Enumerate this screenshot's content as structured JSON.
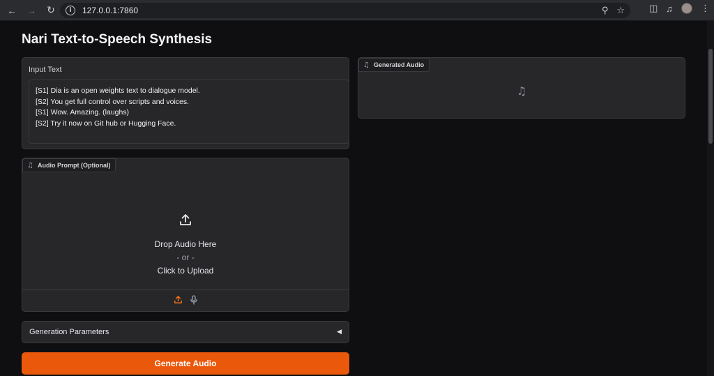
{
  "browser": {
    "url": "127.0.0.1:7860",
    "icons": [
      "back-icon",
      "forward-icon",
      "reload-icon",
      "info-icon",
      "zoom-icon",
      "star-icon",
      "extensions-icon",
      "media-icon",
      "profile-avatar",
      "menu-icon"
    ]
  },
  "app": {
    "title": "Nari Text-to-Speech Synthesis"
  },
  "input_text": {
    "label": "Input Text",
    "lines": [
      "[S1] Dia is an open weights text to dialogue model.",
      "[S2] You get full control over scripts and voices.",
      "[S1] Wow. Amazing. (laughs)",
      "[S2] Try it now on Git hub or Hugging Face."
    ]
  },
  "audio_prompt": {
    "label": "Audio Prompt (Optional)",
    "drop_text": "Drop Audio Here",
    "or_text": "- or -",
    "click_text": "Click to Upload"
  },
  "generated_audio": {
    "label": "Generated Audio"
  },
  "generation_parameters": {
    "label": "Generation Parameters"
  },
  "generate_button": {
    "label": "Generate Audio"
  },
  "colors": {
    "accent": "#ea580c",
    "background": "#0f0f11",
    "panel": "#27272a"
  }
}
